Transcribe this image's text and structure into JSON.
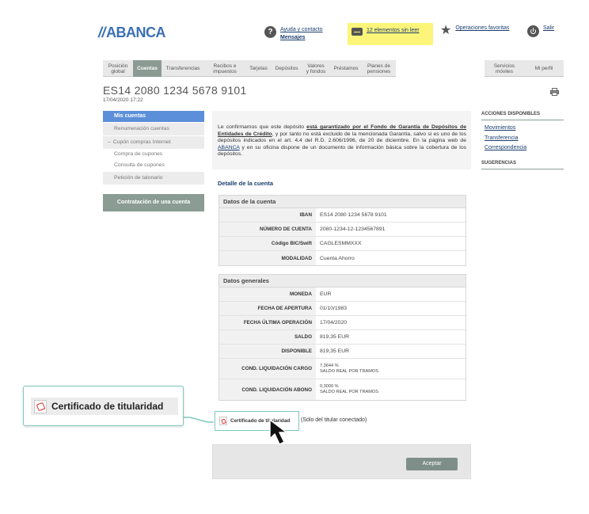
{
  "header": {
    "logo": "ABANCA",
    "help_line1": "Ayuda y contacto",
    "help_line2": "Mensajes",
    "unread": "12 elementos sin leer",
    "favorites": "Operaciones favoritas",
    "exit": "Salir"
  },
  "nav": {
    "items": [
      {
        "label": "Posición global"
      },
      {
        "label": "Cuentas"
      },
      {
        "label": "Transferencias"
      },
      {
        "label": "Recibos e impuestos"
      },
      {
        "label": "Tarjetas"
      },
      {
        "label": "Depósitos"
      },
      {
        "label": "Valores y fondos"
      },
      {
        "label": "Préstamos"
      },
      {
        "label": "Planes de pensiones"
      }
    ],
    "right_items": [
      {
        "label": "Servicios móviles"
      },
      {
        "label": "Mi perfil"
      }
    ]
  },
  "account": {
    "title": "ES14 2080 1234 5678 9101",
    "datetime": "17/04/2020 17:22"
  },
  "left_menu": {
    "head": "Mis cuentas",
    "renumeracion": "Renumeración cuentas",
    "cupon_section": "Cupón compras Internet",
    "compra_cupones": "Compra de cupones",
    "consulta_cupones": "Consulta de cupones",
    "talonario": "Petición de talonario",
    "contratacion": "Contratación de una cuenta"
  },
  "notice": {
    "p1": "Le confirmamos que este depósito ",
    "bold": "está garantizado por el Fondo de Garantía de Depósitos de Entidades de Crédito",
    "p2": ", y por tanto no está excluido de la mencionada Garantía, salvo si es uno de los depósitos indicados en el art. 4.4 del R.D. 2.606/1996, de 20 de diciembre. En la página web de ",
    "link": "ABANCA",
    "p3": " y en su oficina dispone de un documento de información básica sobre la cobertura de los depósitos."
  },
  "detail": {
    "title": "Detalle de la cuenta",
    "datos_cuenta": {
      "head": "Datos de la cuenta",
      "rows": [
        {
          "label": "IBAN",
          "value": "ES14 2080 1234 5678 9101"
        },
        {
          "label": "NÚMERO DE CUENTA",
          "value": "2080-1234-12-1234567891"
        },
        {
          "label": "Código BIC/Swift",
          "value": "CAGLESMMXXX"
        },
        {
          "label": "MODALIDAD",
          "value": "Cuenta Ahorro"
        }
      ]
    },
    "datos_generales": {
      "head": "Datos generales",
      "rows": [
        {
          "label": "MONEDA",
          "value": "EUR"
        },
        {
          "label": "FECHA DE APERTURA",
          "value": "01/10/1983"
        },
        {
          "label": "FECHA ÚLTIMA OPERACIÓN",
          "value": "17/04/2020"
        },
        {
          "label": "SALDO",
          "value": "819,35 EUR"
        },
        {
          "label": "DISPONIBLE",
          "value": "819,35 EUR"
        },
        {
          "label": "COND. LIQUIDACIÓN CARGO",
          "value": "7,3644 %",
          "sub": "SALDO REAL POR TRAMOS"
        },
        {
          "label": "COND. LIQUIDACIÓN ABONO",
          "value": "0,3000 %",
          "sub": "SALDO REAL POR TRAMOS"
        }
      ]
    }
  },
  "certificate": {
    "label": "Certificado de titularidad",
    "note": "(Sólo del titular conectado)"
  },
  "accept_label": "Aceptar",
  "sidebar": {
    "acciones_head": "ACCIONES DISPONIBLES",
    "links": [
      "Movimientos",
      "Transferencia",
      "Correspondencia"
    ],
    "sugerencias_head": "SUGERENCIAS"
  },
  "callout": {
    "label": "Certificado de titularidad"
  },
  "colors": {
    "brand": "#3b6fb6",
    "menu_active": "#5b8fd9",
    "nav_active": "#8c9a94",
    "highlight": "#fdf57a",
    "callout_border": "#7ec9bd"
  }
}
